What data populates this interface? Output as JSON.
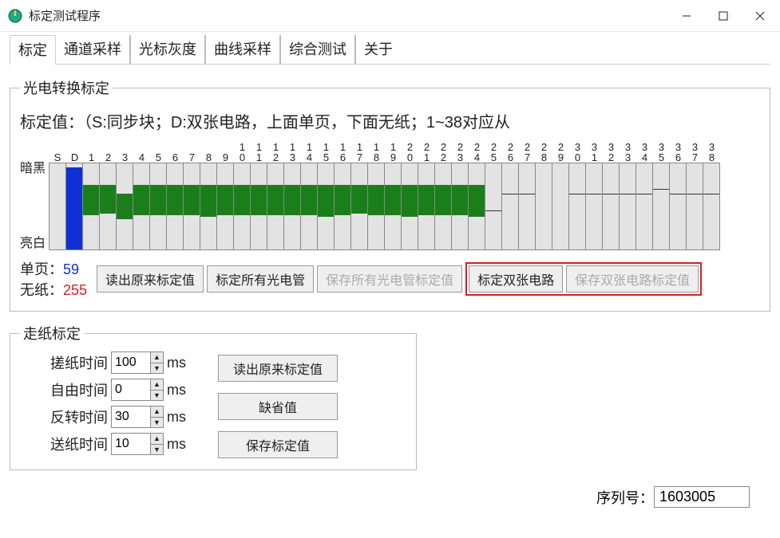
{
  "window": {
    "title": "标定测试程序"
  },
  "tabs": [
    {
      "label": "标定",
      "active": true
    },
    {
      "label": "通道采样",
      "active": false
    },
    {
      "label": "光标灰度",
      "active": false
    },
    {
      "label": "曲线采样",
      "active": false
    },
    {
      "label": "综合测试",
      "active": false
    },
    {
      "label": "关于",
      "active": false
    }
  ],
  "photo_group": {
    "legend": "光电转换标定",
    "description": "标定值：（S:同步块；D:双张电路，上面单页，下面无纸；1~38对应从",
    "y_top": "暗黑",
    "y_bottom": "亮白",
    "readout": {
      "single_label": "单页：",
      "single_value": "59",
      "nopaper_label": "无纸：",
      "nopaper_value": "255"
    },
    "buttons": {
      "read_original": "读出原来标定值",
      "calibrate_all": "标定所有光电管",
      "save_all": "保存所有光电管标定值",
      "calibrate_double": "标定双张电路",
      "save_double": "保存双张电路标定值"
    }
  },
  "chart_data": {
    "type": "bar",
    "title": "光电转换标定",
    "ylabel_top": "暗黑",
    "ylabel_bottom": "亮白",
    "categories": [
      "S",
      "D",
      "1",
      "2",
      "3",
      "4",
      "5",
      "6",
      "7",
      "8",
      "9",
      "10",
      "11",
      "12",
      "13",
      "14",
      "15",
      "16",
      "17",
      "18",
      "19",
      "20",
      "21",
      "22",
      "23",
      "24",
      "25",
      "26",
      "27",
      "28",
      "29",
      "30",
      "31",
      "32",
      "33",
      "34",
      "35",
      "36",
      "37",
      "38"
    ],
    "series": [
      {
        "name": "fill",
        "style": [
          "none",
          "blue",
          "green",
          "green",
          "green",
          "green",
          "green",
          "green",
          "green",
          "green",
          "green",
          "green",
          "green",
          "green",
          "green",
          "green",
          "green",
          "green",
          "green",
          "green",
          "green",
          "green",
          "green",
          "green",
          "green",
          "green",
          "none",
          "none",
          "none",
          "none",
          "none",
          "none",
          "none",
          "none",
          "none",
          "none",
          "none",
          "none",
          "none",
          "none"
        ],
        "top": [
          0,
          5,
          25,
          25,
          35,
          25,
          25,
          25,
          25,
          25,
          25,
          25,
          25,
          25,
          25,
          25,
          25,
          25,
          25,
          25,
          25,
          25,
          25,
          25,
          25,
          25,
          0,
          0,
          0,
          0,
          0,
          0,
          0,
          0,
          0,
          0,
          0,
          0,
          0,
          0
        ],
        "bottom": [
          0,
          100,
          60,
          58,
          65,
          60,
          60,
          60,
          60,
          62,
          60,
          60,
          60,
          60,
          60,
          60,
          62,
          60,
          58,
          60,
          60,
          62,
          60,
          60,
          60,
          62,
          0,
          0,
          0,
          0,
          0,
          0,
          0,
          0,
          0,
          0,
          0,
          0,
          0,
          0
        ]
      },
      {
        "name": "tick",
        "values": [
          null,
          null,
          null,
          null,
          null,
          null,
          null,
          null,
          null,
          null,
          null,
          null,
          null,
          null,
          null,
          null,
          null,
          null,
          null,
          null,
          null,
          null,
          null,
          null,
          null,
          null,
          55,
          35,
          35,
          null,
          null,
          35,
          35,
          35,
          35,
          35,
          30,
          35,
          35,
          35
        ]
      }
    ]
  },
  "paper_group": {
    "legend": "走纸标定",
    "fields": {
      "rub": {
        "label": "搓纸时间",
        "value": "100",
        "unit": "ms"
      },
      "free": {
        "label": "自由时间",
        "value": "0",
        "unit": "ms"
      },
      "reverse": {
        "label": "反转时间",
        "value": "30",
        "unit": "ms"
      },
      "feed": {
        "label": "送纸时间",
        "value": "10",
        "unit": "ms"
      }
    },
    "buttons": {
      "read_original": "读出原来标定值",
      "defaults": "缺省值",
      "save": "保存标定值"
    }
  },
  "serial": {
    "label": "序列号：",
    "value": "1603005"
  }
}
